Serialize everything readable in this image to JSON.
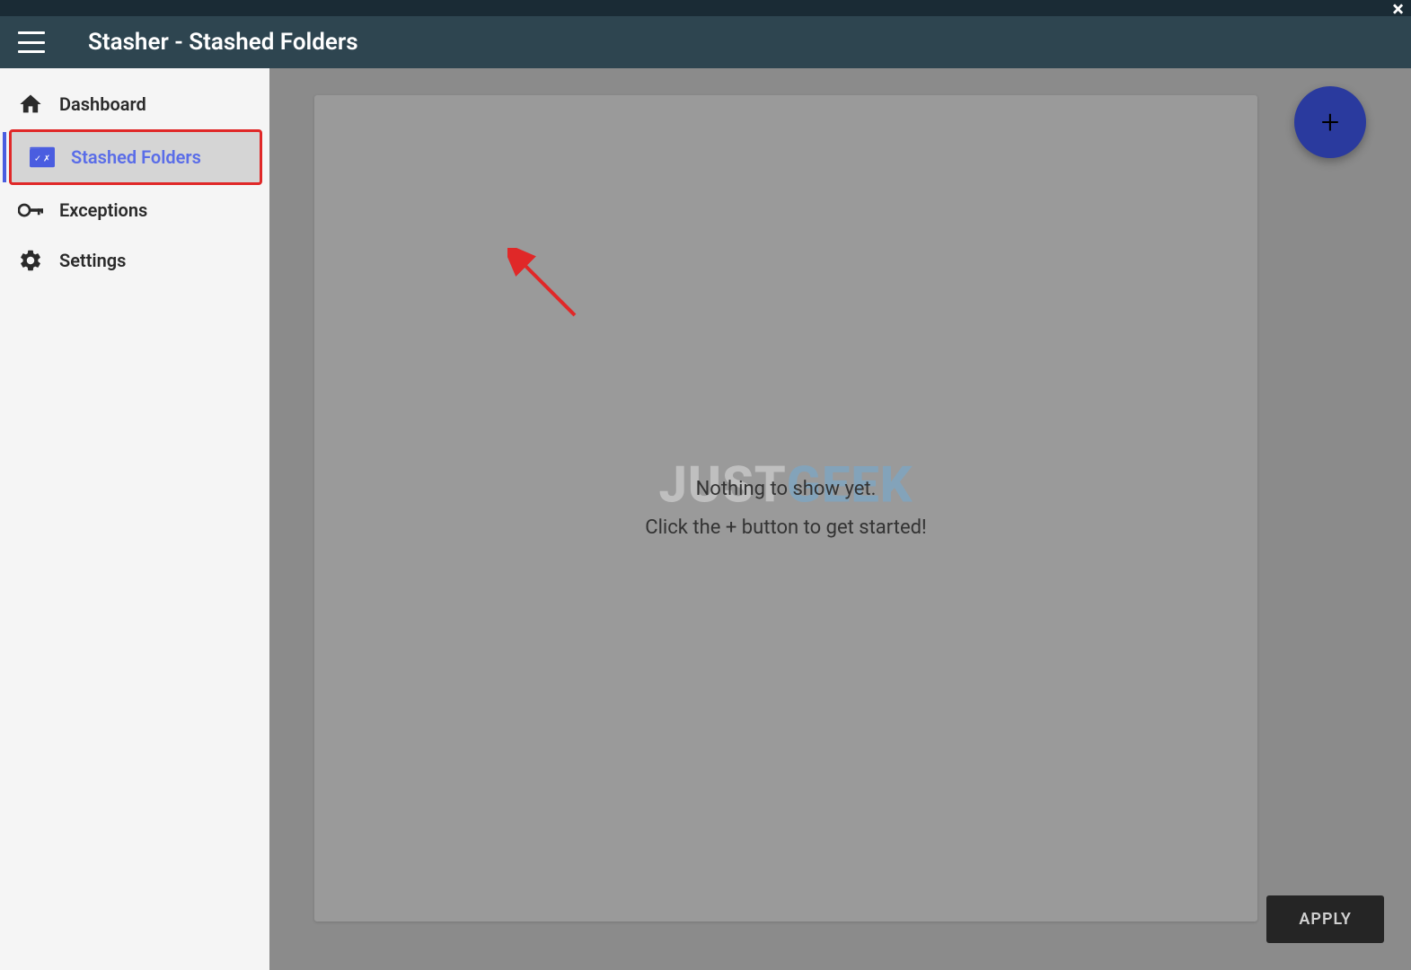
{
  "header": {
    "title": "Stasher - Stashed Folders"
  },
  "sidebar": {
    "items": [
      {
        "label": "Dashboard",
        "icon": "home-icon",
        "active": false
      },
      {
        "label": "Stashed Folders",
        "icon": "folder-check-icon",
        "active": true
      },
      {
        "label": "Exceptions",
        "icon": "key-icon",
        "active": false
      },
      {
        "label": "Settings",
        "icon": "gear-icon",
        "active": false
      }
    ]
  },
  "content": {
    "empty_line1": "Nothing to show yet.",
    "empty_line2": "Click the + button to get started!",
    "fab_label": "+",
    "apply_label": "APPLY"
  },
  "watermark": {
    "part1": "JUST",
    "part2": "GEEK"
  }
}
